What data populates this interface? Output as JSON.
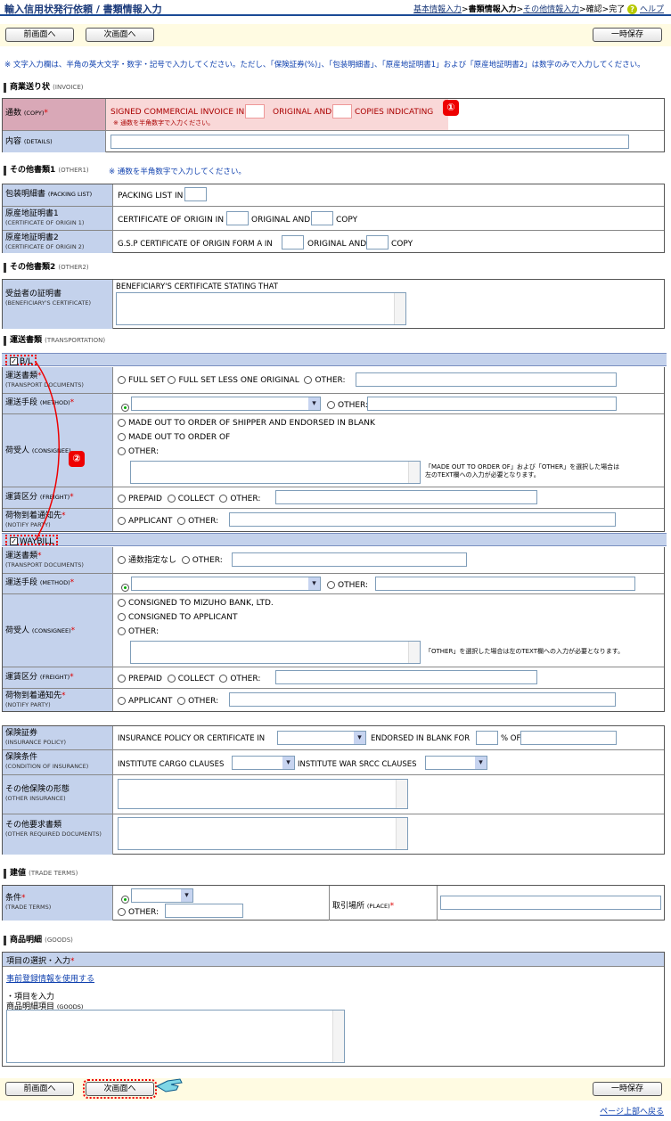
{
  "page": {
    "title": "輸入信用状発行依頼 / 書類情報入力"
  },
  "steps": {
    "basic": "基本情報入力",
    "sep1": ">",
    "docs": "書類情報入力",
    "sep2": ">",
    "other": "その他情報入力",
    "rest": ">確認>完了",
    "help": "ヘルプ"
  },
  "buttons": {
    "prev": "前画面へ",
    "next": "次画面へ",
    "save": "一時保存",
    "top": "ページ上部へ戻る"
  },
  "notice": "※ 文字入力欄は、半角の英大文字・数字・記号で入力してください。ただし、「保険証券(%)」、「包装明細書」、「原産地証明書1」および「原産地証明書2」は数字のみで入力してください。",
  "invoice": {
    "heading": "商業送り状",
    "heading_en": "(INVOICE)",
    "copy_label": "通数",
    "copy_label_en": "(COPY)",
    "req": "*",
    "t1": "SIGNED COMMERCIAL INVOICE IN",
    "t2": "ORIGINAL AND",
    "t3": "COPIES INDICATING",
    "copy_note": "※ 通数を半角数字で入力ください。",
    "details_label": "内容",
    "details_label_en": "(DETAILS)"
  },
  "markers": {
    "m1": "①",
    "m2": "②"
  },
  "other1": {
    "heading": "その他書類1",
    "heading_en": "(OTHER1)",
    "note": "※ 通数を半角数字で入力してください。",
    "packing_label": "包装明細書",
    "packing_label_en": "(PACKING LIST)",
    "packing_text": "PACKING LIST IN",
    "co1_label": "原産地証明書1",
    "co1_label_en": "(CERTIFICATE OF ORIGIN 1)",
    "co1_t1": "CERTIFICATE OF ORIGIN IN",
    "co1_t2": "ORIGINAL AND",
    "co1_t3": "COPY",
    "co2_label": "原産地証明書2",
    "co2_label_en": "(CERTIFICATE OF ORIGIN 2)",
    "co2_t1": "G.S.P CERTIFICATE OF ORIGIN FORM A IN",
    "co2_t2": "ORIGINAL AND",
    "co2_t3": "COPY"
  },
  "other2": {
    "heading": "その他書類2",
    "heading_en": "(OTHER2)",
    "ben_label": "受益者の証明書",
    "ben_label_en": "(BENEFICIARY'S CERTIFICATE)",
    "ben_text": "BENEFICIARY'S CERTIFICATE STATING THAT"
  },
  "transport": {
    "heading": "運送書類",
    "heading_en": "(TRANSPORTATION)",
    "bl": {
      "band": "B/L",
      "doc_label": "運送書類",
      "doc_label_en": "(TRANSPORT DOCUMENTS)",
      "doc_o1": "FULL SET",
      "doc_o2": "FULL SET LESS ONE ORIGINAL",
      "doc_o3": "OTHER:",
      "method_label": "運送手段",
      "method_label_en": "(METHOD)",
      "other": "OTHER:",
      "cons_label": "荷受人",
      "cons_label_en": "(CONSIGNEE)",
      "cons_o1": "MADE OUT TO ORDER OF SHIPPER AND ENDORSED IN BLANK",
      "cons_o2": "MADE OUT TO ORDER OF",
      "cons_o3": "OTHER:",
      "cons_note": "「MADE OUT TO ORDER OF」および「OTHER」を選択した場合は左のTEXT欄への入力が必要となります。",
      "freight_label": "運賃区分",
      "freight_label_en": "(FREIGHT)",
      "fr_o1": "PREPAID",
      "fr_o2": "COLLECT",
      "fr_o3": "OTHER:",
      "notify_label": "荷物到着通知先",
      "notify_label_en": "(NOTIFY PARTY)",
      "nt_o1": "APPLICANT",
      "nt_o2": "OTHER:"
    },
    "wb": {
      "band": "WAYBILL",
      "doc_o1": "通数指定なし",
      "doc_o2": "OTHER:",
      "cons_o1": "CONSIGNED TO MIZUHO BANK, LTD.",
      "cons_o2": "CONSIGNED TO APPLICANT",
      "cons_o3": "OTHER:",
      "cons_note": "「OTHER」を選択した場合は左のTEXT欄への入力が必要となります。"
    }
  },
  "insurance": {
    "policy_label": "保険証券",
    "policy_label_en": "(INSURANCE POLICY)",
    "policy_t1": "INSURANCE POLICY OR CERTIFICATE IN",
    "policy_t2": "ENDORSED IN BLANK FOR",
    "policy_t3": "% OF",
    "cond_label": "保険条件",
    "cond_label_en": "(CONDITION OF INSURANCE)",
    "cond_t1": "INSTITUTE CARGO CLAUSES",
    "cond_t2": "INSTITUTE WAR SRCC CLAUSES",
    "oi_label": "その他保険の形態",
    "oi_label_en": "(OTHER INSURANCE)",
    "od_label": "その他要求書類",
    "od_label_en": "(OTHER REQUIRED DOCUMENTS)"
  },
  "trade": {
    "heading": "建値",
    "heading_en": "(TRADE TERMS)",
    "terms_label": "条件",
    "terms_label_en": "(TRADE TERMS)",
    "other": "OTHER:",
    "place_label": "取引場所",
    "place_label_en": "(PLACE)"
  },
  "goods": {
    "heading": "商品明細",
    "heading_en": "(GOODS)",
    "band": "項目の選択・入力",
    "link": "事前登録情報を使用する",
    "input_label": "・項目を入力",
    "item_label": "商品明細項目",
    "item_label_en": "(GOODS)"
  }
}
